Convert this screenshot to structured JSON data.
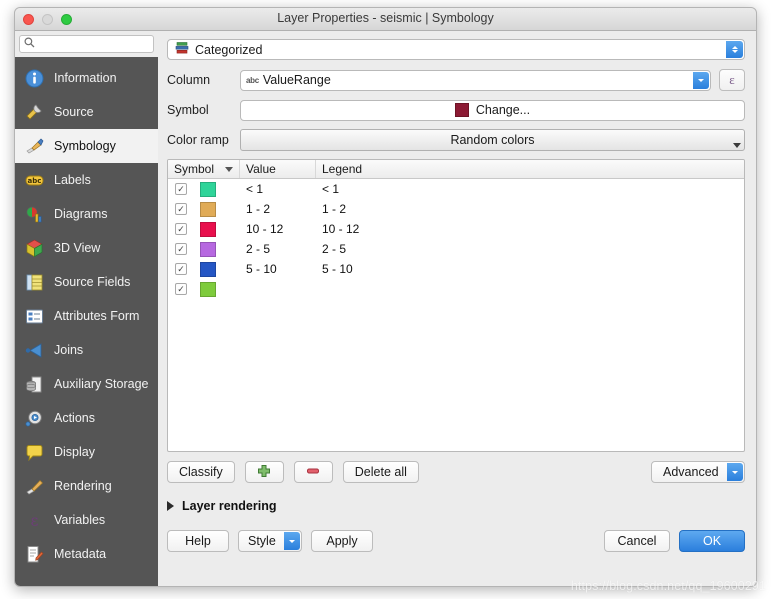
{
  "window": {
    "title": "Layer Properties - seismic | Symbology",
    "traffic_lights": [
      "close-red",
      "minimize-gray",
      "zoom-green"
    ]
  },
  "sidebar": {
    "search": {
      "value": "",
      "placeholder": "",
      "icon": "search-icon"
    },
    "items": [
      {
        "label": "Information",
        "icon": "information-icon",
        "active": false
      },
      {
        "label": "Source",
        "icon": "source-icon",
        "active": false
      },
      {
        "label": "Symbology",
        "icon": "symbology-brush-icon",
        "active": true
      },
      {
        "label": "Labels",
        "icon": "labels-abc-icon",
        "active": false
      },
      {
        "label": "Diagrams",
        "icon": "diagrams-icon",
        "active": false
      },
      {
        "label": "3D View",
        "icon": "cube-3d-icon",
        "active": false
      },
      {
        "label": "Source Fields",
        "icon": "source-fields-icon",
        "active": false
      },
      {
        "label": "Attributes Form",
        "icon": "attributes-form-icon",
        "active": false
      },
      {
        "label": "Joins",
        "icon": "joins-icon",
        "active": false
      },
      {
        "label": "Auxiliary Storage",
        "icon": "auxiliary-storage-icon",
        "active": false
      },
      {
        "label": "Actions",
        "icon": "actions-gear-icon",
        "active": false
      },
      {
        "label": "Display",
        "icon": "display-balloon-icon",
        "active": false
      },
      {
        "label": "Rendering",
        "icon": "rendering-brush-icon",
        "active": false
      },
      {
        "label": "Variables",
        "icon": "variables-epsilon-icon",
        "active": false
      },
      {
        "label": "Metadata",
        "icon": "metadata-icon",
        "active": false
      }
    ]
  },
  "main": {
    "renderer": {
      "value": "Categorized",
      "icon": "categorized-icon"
    },
    "column": {
      "label": "Column",
      "value": "ValueRange",
      "type_badge": "abc",
      "expression_button": "ε"
    },
    "symbol": {
      "label": "Symbol",
      "change_label": "Change...",
      "color": "#8c1a34"
    },
    "color_ramp": {
      "label": "Color ramp",
      "value": "Random colors"
    },
    "table": {
      "headers": [
        "Symbol",
        "Value",
        "Legend"
      ],
      "sort_indicator_column": "Symbol",
      "rows": [
        {
          "checked": true,
          "color": "#2fd499",
          "value": "< 1",
          "legend": "< 1"
        },
        {
          "checked": true,
          "color": "#e0ab57",
          "value": "1 - 2",
          "legend": "1 - 2"
        },
        {
          "checked": true,
          "color": "#e8104d",
          "value": "10 - 12",
          "legend": "10 - 12"
        },
        {
          "checked": true,
          "color": "#b668e0",
          "value": "2 - 5",
          "legend": "2 - 5"
        },
        {
          "checked": true,
          "color": "#2556c4",
          "value": "5 - 10",
          "legend": "5 - 10"
        },
        {
          "checked": true,
          "color": "#7ecb3c",
          "value": "",
          "legend": ""
        }
      ]
    },
    "actions": {
      "classify": "Classify",
      "add": "add-category-icon",
      "remove": "remove-category-icon",
      "delete_all": "Delete all",
      "advanced": "Advanced"
    },
    "layer_rendering": {
      "label": "Layer rendering",
      "expanded": false
    }
  },
  "footer": {
    "help": "Help",
    "style": "Style",
    "apply": "Apply",
    "cancel": "Cancel",
    "ok": "OK"
  },
  "watermark": {
    "text": "https://blog.csdn.net/qq_19600291"
  }
}
